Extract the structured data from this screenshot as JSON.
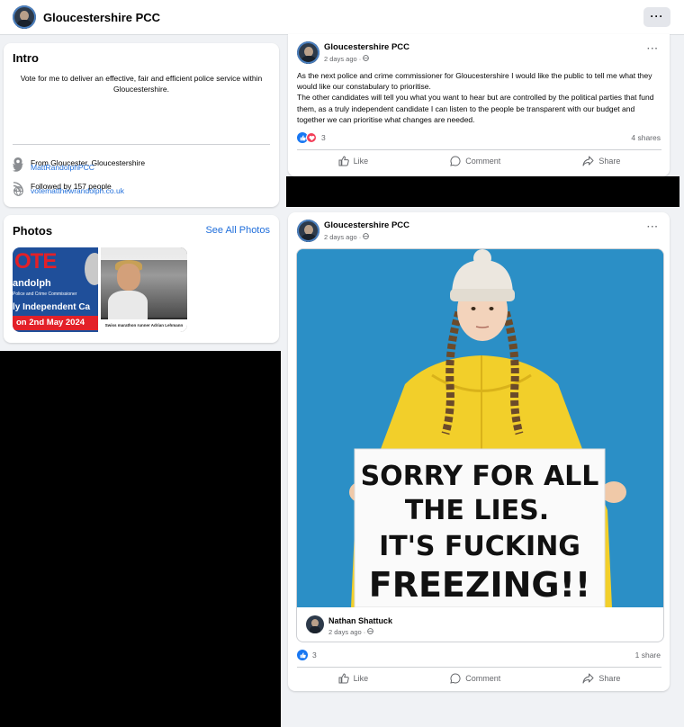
{
  "topbar": {
    "page_name": "Gloucestershire PCC",
    "more": "···"
  },
  "intro": {
    "heading": "Intro",
    "bio": "Vote for me to deliver an effective, fair and efficient police service within Gloucestershire.",
    "location": "From Gloucester, Gloucestershire",
    "followers": "Followed by 157 people",
    "twitter": "MattRandolphPCC",
    "website": "votematthewrandolph.co.uk"
  },
  "photos": {
    "heading": "Photos",
    "see_all": "See All Photos",
    "thumb1": {
      "vote": "OTE",
      "name": "andolph",
      "role": "Police and Crime Commissioner",
      "independent": "ly Independent Ca",
      "date": "on 2nd May 2024"
    },
    "thumb2": {
      "caption": "Swiss marathon runner Adrian Lehmann"
    }
  },
  "post1": {
    "author": "Gloucestershire PCC",
    "time": "2 days ago · ",
    "more": "···",
    "text_p1": "As the next police and crime commissioner for Gloucestershire I would like the public to tell me what they would like our constabulary to prioritise.",
    "text_p2": "The other candidates will tell you what you want to hear but are controlled by the political parties that fund them, as a truly independent candidate I can listen to the people be transparent with our budget and together we can prioritise what changes are needed.",
    "reaction_count": "3",
    "shares": "4 shares",
    "like": "Like",
    "comment": "Comment",
    "share": "Share"
  },
  "post2": {
    "author": "Gloucestershire PCC",
    "time": "2 days ago · ",
    "more": "···",
    "sign_line1": "SORRY FOR ALL",
    "sign_line2": "THE LIES.",
    "sign_line3": "IT'S FUCKING",
    "sign_line4": "FREEZING!!",
    "shared_author": "Nathan Shattuck",
    "shared_time": "2 days ago · ",
    "reaction_count": "3",
    "shares": "1 share",
    "like": "Like",
    "comment": "Comment",
    "share": "Share"
  },
  "colors": {
    "link": "#216fdb",
    "like": "#1877f2",
    "love": "#f33e58",
    "sky": "#2b8fc6",
    "raincoat": "#f2cf2a"
  }
}
